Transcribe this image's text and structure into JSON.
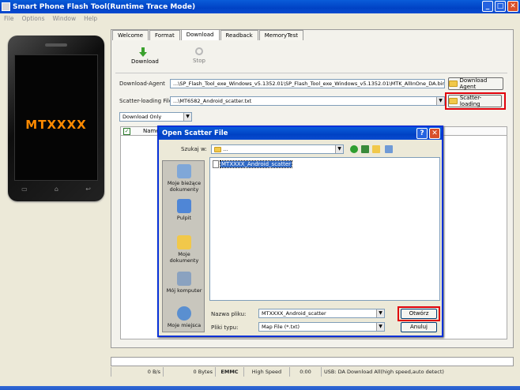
{
  "window": {
    "title": "Smart Phone Flash Tool(Runtime Trace Mode)",
    "min": "_",
    "max": "□",
    "close": "✕"
  },
  "menu": [
    "File",
    "Options",
    "Window",
    "Help"
  ],
  "phone": {
    "brand": "MTXXXX",
    "keys": [
      "▭",
      "⌂",
      "↩"
    ]
  },
  "tabs": [
    "Welcome",
    "Format",
    "Download",
    "Readback",
    "MemoryTest"
  ],
  "toolbar": {
    "download": "Download",
    "stop": "Stop"
  },
  "form": {
    "agent_label": "Download-Agent",
    "agent_value": "...\\SP_Flash_Tool_exe_Windows_v5.1352.01\\SP_Flash_Tool_exe_Windows_v5.1352.01\\MTK_AllInOne_DA.bin",
    "agent_button": "Download Agent",
    "scatter_label": "Scatter-loading File",
    "scatter_value": "...\\MT6582_Android_scatter.txt",
    "scatter_button": "Scatter-loading",
    "mode_value": "Download Only",
    "table_header": "Name"
  },
  "statusbar": [
    "0 B/s",
    "0 Bytes",
    "EMMC",
    "High Speed",
    "0:00",
    "USB: DA Download All(high speed,auto detect)"
  ],
  "dialog": {
    "title": "Open Scatter File",
    "help": "?",
    "close": "✕",
    "lookin_label": "Szukaj w:",
    "lookin_value": "...",
    "places": [
      "Moje bieżące dokumenty",
      "Pulpit",
      "Moje dokumenty",
      "Mój komputer",
      "Moje miejsca"
    ],
    "file": "MTXXXX_Android_scatter",
    "filename_label": "Nazwa pliku:",
    "filename_value": "MTXXXX_Android_scatter",
    "filetype_label": "Pliki typu:",
    "filetype_value": "Map File (*.txt)",
    "open_button": "Otwórz",
    "cancel_button": "Anuluj"
  },
  "colors": {
    "highlight": "#e0000a",
    "titlebar": "#0a5cd9",
    "brand": "#ff8a00"
  }
}
